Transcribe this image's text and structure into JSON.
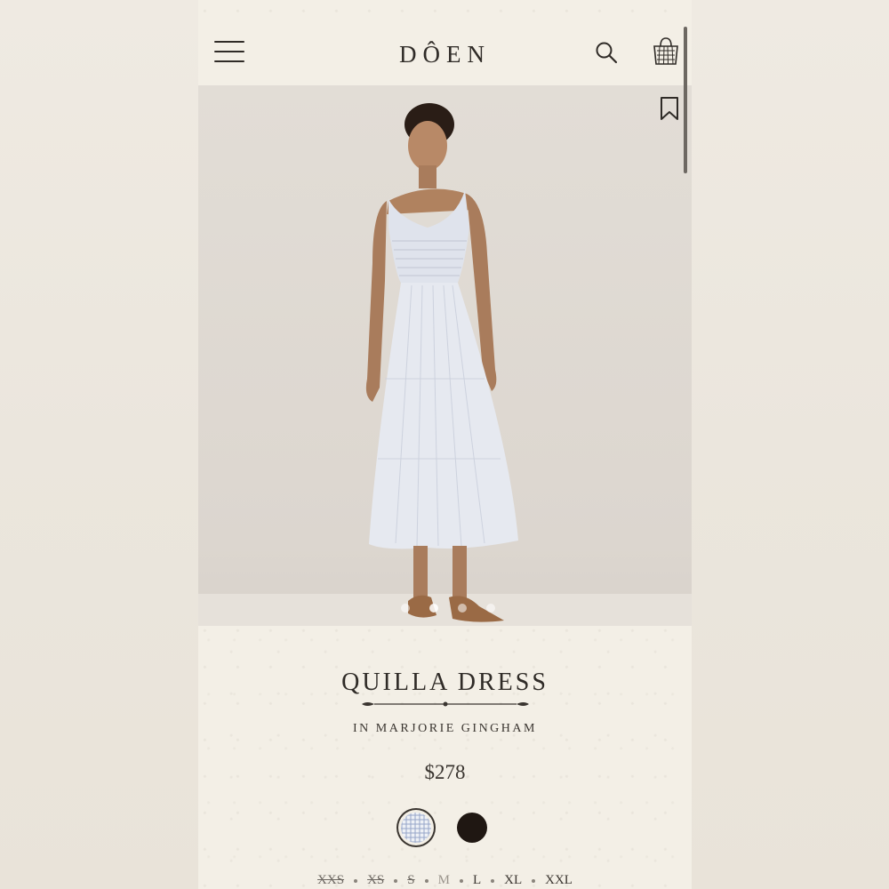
{
  "header": {
    "logo": "DÔEN",
    "menu_icon": "hamburger-menu-icon",
    "search_icon": "search-icon",
    "bag_icon": "shopping-basket-icon"
  },
  "gallery": {
    "bookmark_icon": "bookmark-icon",
    "image_alt": "Model wearing light blue gingham smocked midi dress with strappy sandals",
    "slide_count": 4,
    "active_slide": 1
  },
  "product": {
    "name": "QUILLA DRESS",
    "variant": "IN MARJORIE GINGHAM",
    "price": "$278",
    "colors": [
      {
        "name": "Marjorie Gingham",
        "swatch": "#eef1f6",
        "selected": true
      },
      {
        "name": "Black",
        "swatch": "#1f1712",
        "selected": false
      }
    ],
    "sizes": [
      {
        "label": "XXS",
        "status": "sold-out"
      },
      {
        "label": "XS",
        "status": "sold-out"
      },
      {
        "label": "S",
        "status": "sold-out"
      },
      {
        "label": "M",
        "status": "unavailable"
      },
      {
        "label": "L",
        "status": "available"
      },
      {
        "label": "XL",
        "status": "available"
      },
      {
        "label": "XXL",
        "status": "available"
      }
    ]
  },
  "colors": {
    "background": "#f3efe6",
    "text": "#3a3530",
    "accent_dark": "#2f2b27"
  }
}
